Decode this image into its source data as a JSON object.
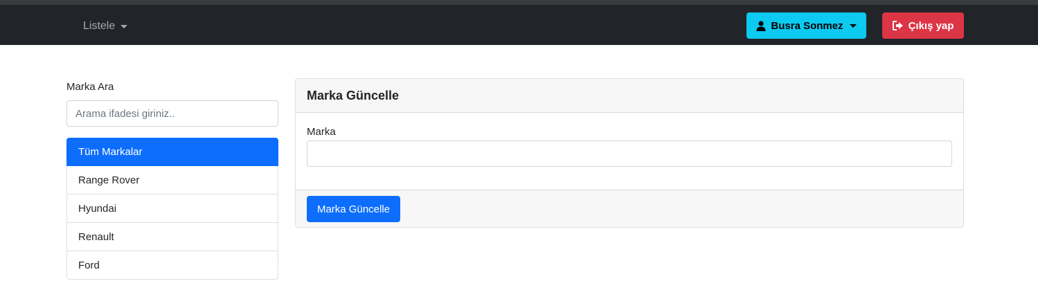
{
  "navbar": {
    "list_dropdown": "Listele",
    "user_button": "Busra Sonmez",
    "logout_button": "Çıkış yap"
  },
  "search": {
    "label": "Marka Ara",
    "placeholder": "Arama ifadesi giriniz..",
    "value": ""
  },
  "brands": {
    "items": [
      {
        "label": "Tüm Markalar",
        "active": true
      },
      {
        "label": "Range Rover"
      },
      {
        "label": "Hyundai"
      },
      {
        "label": "Renault"
      },
      {
        "label": "Ford"
      }
    ]
  },
  "card": {
    "title": "Marka Güncelle",
    "field_label": "Marka",
    "field_value": "",
    "submit_label": "Marka Güncelle"
  },
  "colors": {
    "navbar_bg": "#212529",
    "info": "#0dcaf0",
    "danger": "#dc3545",
    "primary": "#0d6efd"
  },
  "icons": {
    "user": "user-icon",
    "logout": "sign-out-icon",
    "caret": "caret-down-icon"
  }
}
